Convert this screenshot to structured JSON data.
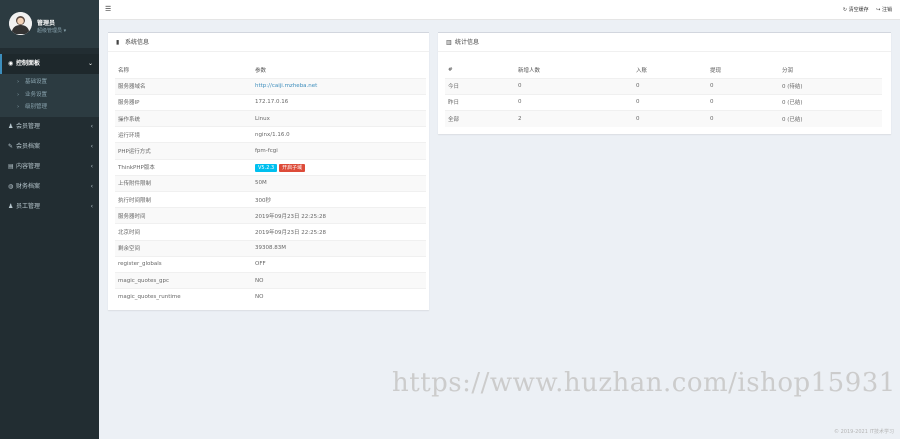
{
  "user": {
    "name": "管理员",
    "role": "超级管理员 ▾"
  },
  "sidebar": {
    "items": [
      {
        "icon": "gauge-icon",
        "glyph": "◉",
        "label": "控制面板",
        "active": true
      },
      {
        "icon": "user-icon",
        "glyph": "♟",
        "label": "会员管理"
      },
      {
        "icon": "edit-icon",
        "glyph": "✎",
        "label": "会员档案"
      },
      {
        "icon": "book-icon",
        "glyph": "▤",
        "label": "内容管理"
      },
      {
        "icon": "money-icon",
        "glyph": "◍",
        "label": "财务档案"
      },
      {
        "icon": "team-icon",
        "glyph": "♟",
        "label": "员工管理"
      }
    ],
    "submenu": [
      {
        "label": "基础设置"
      },
      {
        "label": "业务设置"
      },
      {
        "label": "级别管理"
      }
    ]
  },
  "topbar": {
    "toggle_glyph": "☰",
    "clear_cache": "↻ 清空缓存",
    "logout": "↪ 注销"
  },
  "system_box": {
    "title": "系统信息",
    "header": [
      "名称",
      "参数"
    ],
    "rows": [
      {
        "name": "服务器域名",
        "value": "http://caiji.mzheba.net",
        "link": true
      },
      {
        "name": "服务器IP",
        "value": "172.17.0.16"
      },
      {
        "name": "操作系统",
        "value": "Linux"
      },
      {
        "name": "运行环境",
        "value": "nginx/1.16.0"
      },
      {
        "name": "PHP运行方式",
        "value": "fpm-fcgi"
      },
      {
        "name": "ThinkPHP版本",
        "value": "",
        "badges": [
          "V5.2.3",
          "开启子域"
        ]
      },
      {
        "name": "上传附件限制",
        "value": "50M"
      },
      {
        "name": "执行时间限制",
        "value": "300秒"
      },
      {
        "name": "服务器时间",
        "value": "2019年09月23日 22:25:28"
      },
      {
        "name": "北京时间",
        "value": "2019年09月23日 22:25:28"
      },
      {
        "name": "剩余空间",
        "value": "39308.83M"
      },
      {
        "name": "register_globals",
        "value": "OFF"
      },
      {
        "name": "magic_quotes_gpc",
        "value": "NO"
      },
      {
        "name": "magic_quotes_runtime",
        "value": "NO"
      }
    ]
  },
  "stats_box": {
    "title": "统计信息",
    "header": [
      "#",
      "新增人数",
      "入账",
      "提现",
      "分润"
    ],
    "rows": [
      [
        "今日",
        "0",
        "0",
        "0",
        "0 (待结)"
      ],
      [
        "昨日",
        "0",
        "0",
        "0",
        "0 (已结)"
      ],
      [
        "全部",
        "2",
        "0",
        "0",
        "0 (已结)"
      ]
    ]
  },
  "watermark": "https://www.huzhan.com/ishop15931",
  "footer": "© 2019-2021 IT技术学习",
  "colors": {
    "sidebar": "#222d32",
    "accent": "#3c8dbc",
    "info": "#00c0ef",
    "danger": "#dd4b39"
  }
}
